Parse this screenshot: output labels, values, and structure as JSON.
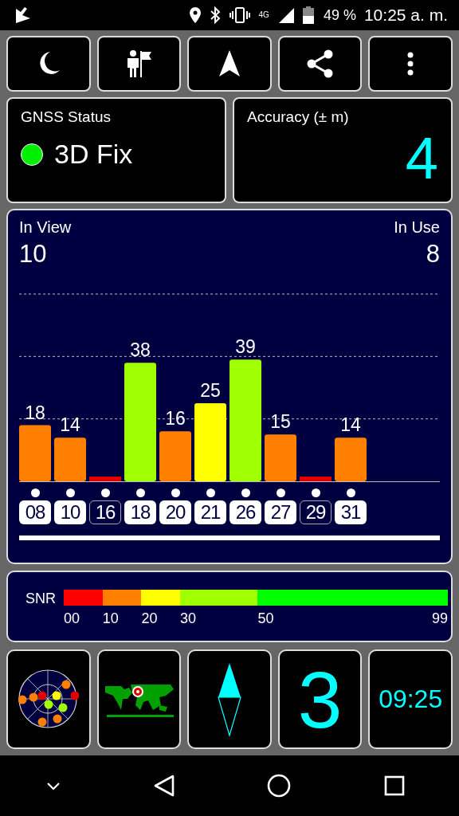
{
  "status_bar": {
    "network": "4G",
    "battery": "49 %",
    "time": "10:25 a. m."
  },
  "gnss_status": {
    "title": "GNSS Status",
    "value": "3D Fix"
  },
  "accuracy": {
    "title": "Accuracy (± m)",
    "value": "4"
  },
  "satellites_panel": {
    "in_view_label": "In View",
    "in_view": "10",
    "in_use_label": "In Use",
    "in_use": "8",
    "satellites": [
      {
        "prn": "08",
        "snr": "18",
        "color": "#ff8000",
        "in_use": true
      },
      {
        "prn": "10",
        "snr": "14",
        "color": "#ff8000",
        "in_use": true
      },
      {
        "prn": "16",
        "color": "#e00000",
        "in_use": false
      },
      {
        "prn": "18",
        "snr": "38",
        "color": "#a0ff00",
        "in_use": true
      },
      {
        "prn": "20",
        "snr": "16",
        "color": "#ff8000",
        "in_use": true
      },
      {
        "prn": "21",
        "snr": "25",
        "color": "#ffff00",
        "in_use": true
      },
      {
        "prn": "26",
        "snr": "39",
        "color": "#a0ff00",
        "in_use": true
      },
      {
        "prn": "27",
        "snr": "15",
        "color": "#ff8000",
        "in_use": true
      },
      {
        "prn": "29",
        "color": "#e00000",
        "in_use": false
      },
      {
        "prn": "31",
        "snr": "14",
        "color": "#ff8000",
        "in_use": true
      }
    ]
  },
  "snr_legend": {
    "label": "SNR",
    "segments": [
      {
        "label": "00",
        "color": "#ff0000"
      },
      {
        "label": "10",
        "color": "#ff8000"
      },
      {
        "label": "20",
        "color": "#ffff00"
      },
      {
        "label": "30",
        "color": "#a0ff00"
      },
      {
        "label": "50",
        "color": "#00ff00"
      }
    ],
    "end_label": "99"
  },
  "tiles": {
    "satellites_used": "3",
    "time": "09:25"
  }
}
